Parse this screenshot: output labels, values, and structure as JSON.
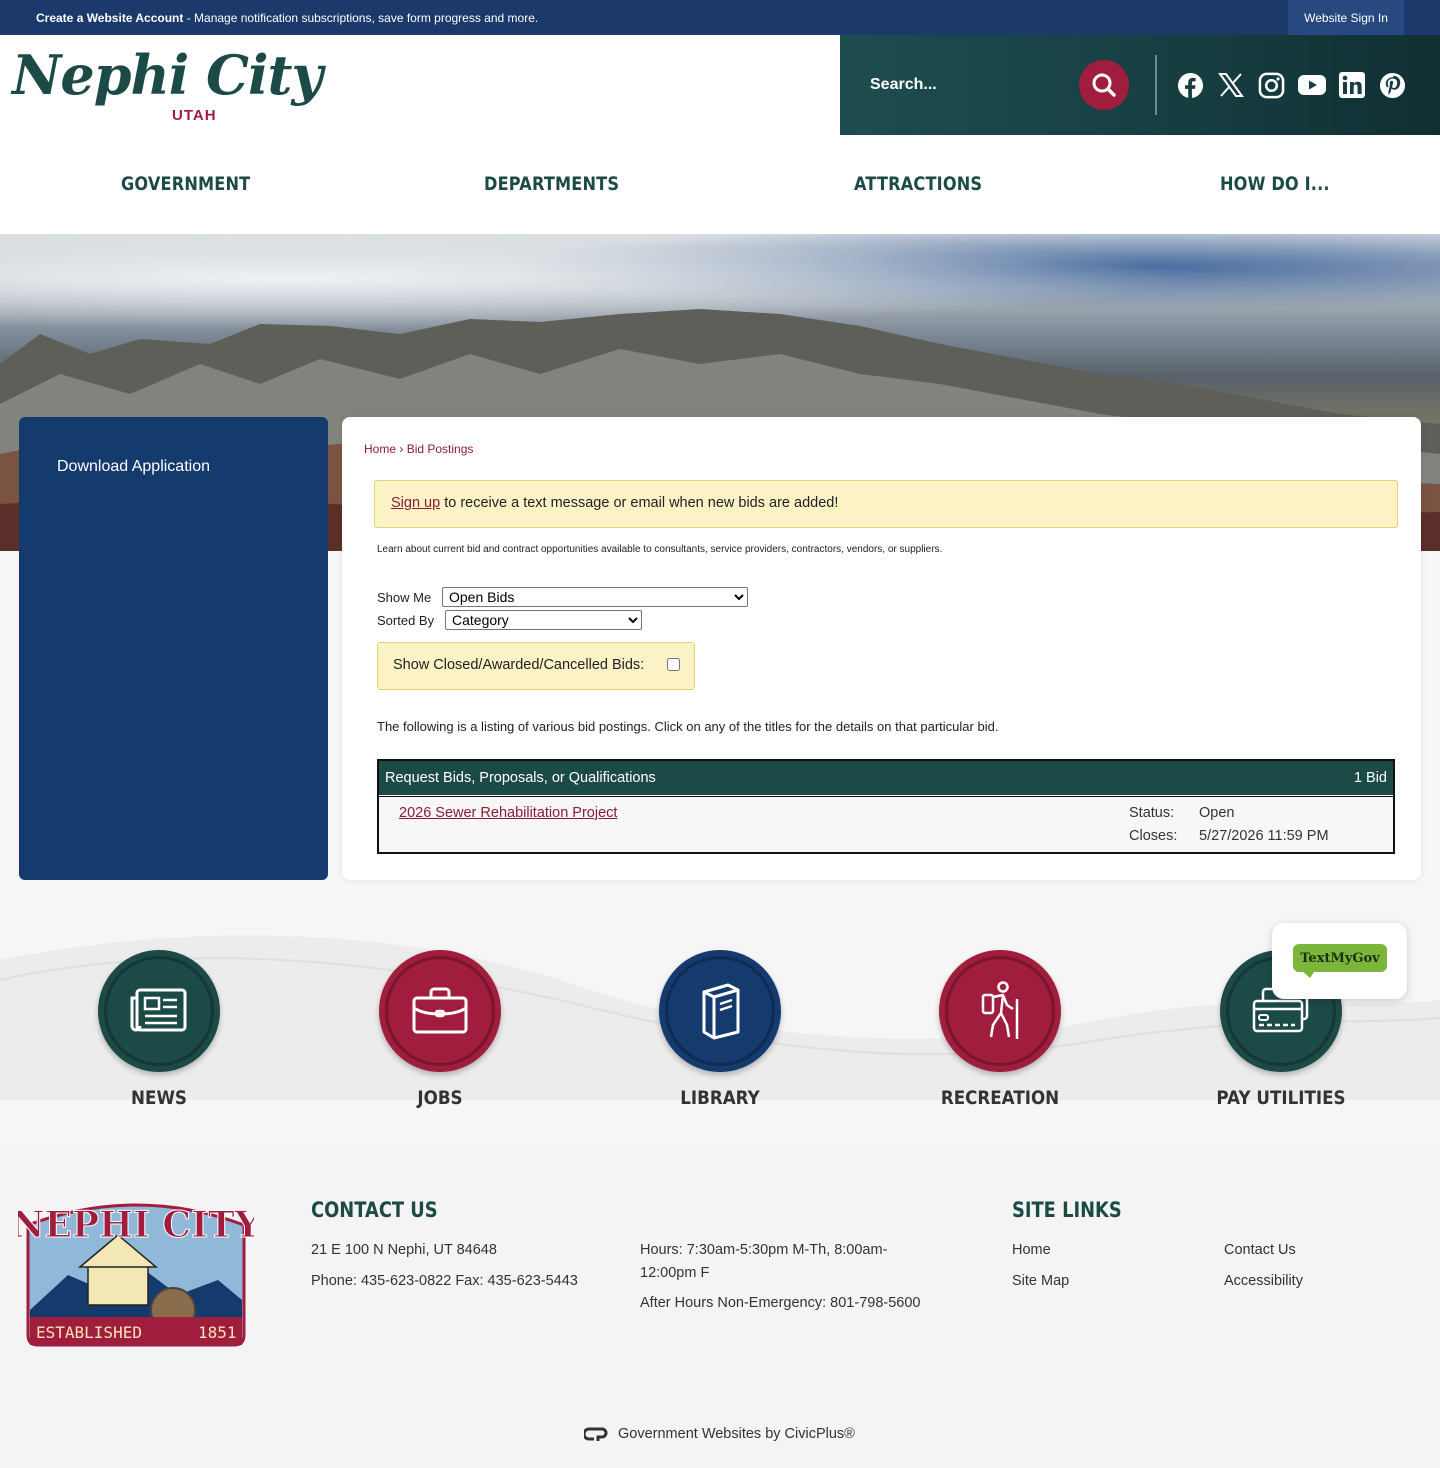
{
  "topbar": {
    "create_account": "Create a Website Account",
    "message": " - Manage notification subscriptions, save form progress and more.",
    "sign_in": "Website Sign In"
  },
  "header": {
    "logo_text": "Nephi City",
    "logo_sub": "UTAH",
    "search_placeholder": "Search...",
    "social": [
      "facebook-icon",
      "x-icon",
      "instagram-icon",
      "youtube-icon",
      "linkedin-icon",
      "pinterest-icon"
    ]
  },
  "nav": [
    "GOVERNMENT",
    "DEPARTMENTS",
    "ATTRACTIONS",
    "HOW DO I..."
  ],
  "sidebar": {
    "items": [
      "Download Application"
    ]
  },
  "main": {
    "breadcrumb": {
      "home": "Home",
      "sep": " › ",
      "current": "Bid Postings"
    },
    "alert": {
      "link": "Sign up",
      "text": " to receive a text message or email when new bids are added!"
    },
    "intro": "Learn about current bid and contract opportunities available to consultants, service providers, contractors, vendors, or suppliers.",
    "show_me_label": "Show Me",
    "show_me_value": "Open Bids",
    "sorted_by_label": "Sorted By",
    "sorted_by_value": "Category",
    "closed_label": "Show Closed/Awarded/Cancelled Bids:",
    "listing_text": "The following is a listing of various bid postings. Click on any of the titles for the details on that particular bid.",
    "table": {
      "category": "Request Bids, Proposals, or Qualifications",
      "count": "1 Bid",
      "rows": [
        {
          "title": "2026 Sewer Rehabilitation Project",
          "status_label": "Status:",
          "status": "Open",
          "closes_label": "Closes:",
          "closes": "5/27/2026 11:59 PM"
        }
      ]
    }
  },
  "quick_links": [
    {
      "label": "NEWS",
      "icon": "news-icon",
      "color": "#1c4a47"
    },
    {
      "label": "JOBS",
      "icon": "briefcase-icon",
      "color": "#a11d3d"
    },
    {
      "label": "LIBRARY",
      "icon": "book-icon",
      "color": "#153a6e"
    },
    {
      "label": "RECREATION",
      "icon": "hiker-icon",
      "color": "#a11d3d"
    },
    {
      "label": "PAY UTILITIES",
      "icon": "payment-card-icon",
      "color": "#1c4a47"
    }
  ],
  "textmygov": "TextMyGov",
  "footer": {
    "seal": {
      "top": "NEPHI CITY",
      "left": "ESTABLISHED",
      "right": "1851"
    },
    "contact_heading": "CONTACT US",
    "address": "21 E 100 N Nephi, UT 84648",
    "phone": "Phone: 435-623-0822 Fax: 435-623-5443",
    "hours": "Hours: 7:30am-5:30pm M-Th, 8:00am-12:00pm F",
    "after_hours": "After Hours Non-Emergency: 801-798-5600",
    "links_heading": "SITE LINKS",
    "links": [
      "Home",
      "Contact Us",
      "Site Map",
      "Accessibility"
    ],
    "powered": "Government Websites by CivicPlus®"
  },
  "colors": {
    "navy": "#1b3a6b",
    "teal": "#1c4a47",
    "maroon": "#a11d3d",
    "alert": "#fbf3c6"
  }
}
